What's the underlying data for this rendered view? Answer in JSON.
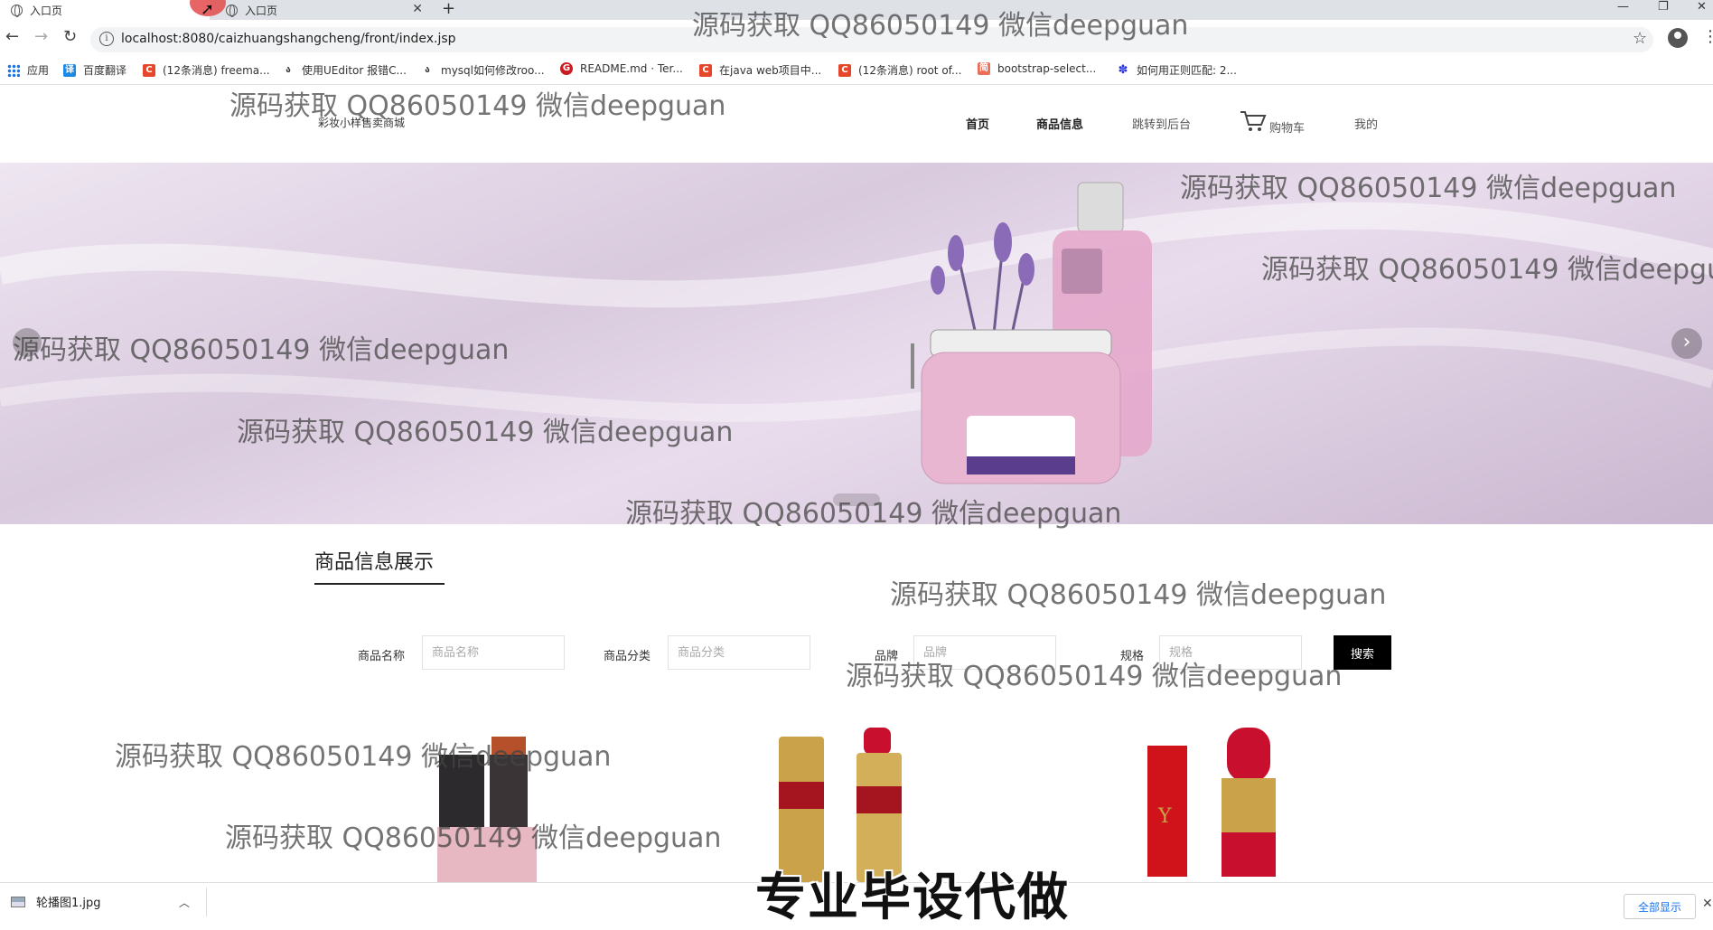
{
  "browser": {
    "tabs": [
      {
        "title": "入口页"
      },
      {
        "title": "入口页"
      }
    ],
    "new_tab": "+",
    "url": "localhost:8080/caizhuangshangcheng/front/index.jsp",
    "bookmarks": [
      {
        "label": "应用",
        "icon": "apps-icon"
      },
      {
        "label": "百度翻译",
        "icon": "baidu-translate-icon",
        "color": "#1e88e5"
      },
      {
        "label": "(12条消息) freema...",
        "icon": "csdn-icon",
        "color": "#e5472b"
      },
      {
        "label": "使用UEditor 报错C...",
        "icon": "cnblogs-icon"
      },
      {
        "label": "mysql如何修改roo...",
        "icon": "cnblogs-icon"
      },
      {
        "label": "README.md · Ter...",
        "icon": "gitee-icon",
        "color": "#c71d23"
      },
      {
        "label": "在java web项目中...",
        "icon": "csdn-icon",
        "color": "#e5472b"
      },
      {
        "label": "(12条消息) root of...",
        "icon": "csdn-icon",
        "color": "#e5472b"
      },
      {
        "label": "bootstrap-select...",
        "icon": "jianshu-icon",
        "color": "#ea6f5a"
      },
      {
        "label": "如何用正则匹配: 2...",
        "icon": "baidu-paw-icon",
        "color": "#2932e1"
      }
    ]
  },
  "site": {
    "title": "彩妆小样售卖商城",
    "nav": {
      "home": "首页",
      "products": "商品信息",
      "admin": "跳转到后台",
      "cart": "购物车",
      "mine": "我的"
    }
  },
  "section": {
    "title": "商品信息展示"
  },
  "search": {
    "fields": [
      {
        "label": "商品名称",
        "placeholder": "商品名称"
      },
      {
        "label": "商品分类",
        "placeholder": "商品分类"
      },
      {
        "label": "品牌",
        "placeholder": "品牌"
      },
      {
        "label": "规格",
        "placeholder": "规格"
      }
    ],
    "button": "搜索"
  },
  "download": {
    "file": "轮播图1.jpg",
    "show_all": "全部显示"
  },
  "watermark": "源码获取 QQ86050149 微信deepguan",
  "watermark_cut": "源码获取 QQ86050149 微信deepgu",
  "promo": "专业毕设代做",
  "colors": {
    "accent": "#000000",
    "banner": "#d9cade",
    "lipstick_red": "#c8102e",
    "gold": "#c9a24a"
  }
}
